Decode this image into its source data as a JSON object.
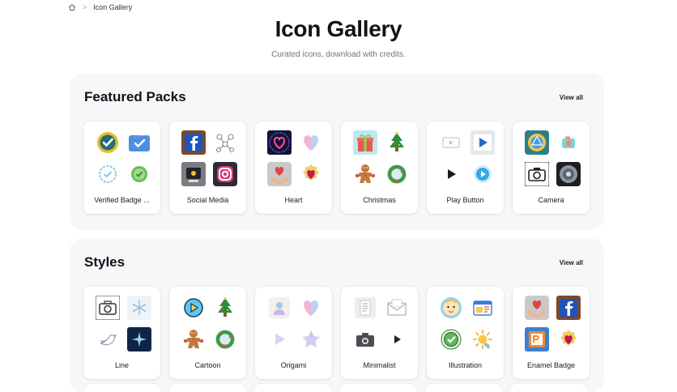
{
  "breadcrumb": {
    "home_icon": "home-icon",
    "separator": ">",
    "current": "Icon Gallery"
  },
  "page": {
    "title": "Icon Gallery",
    "subtitle": "Curated icons, download with credits."
  },
  "featured": {
    "title": "Featured Packs",
    "view_all": "View all",
    "packs": [
      {
        "label": "Verified Badge ...",
        "icons": [
          "verified-badge-icon",
          "verified-folder-icon",
          "check-circle-icon",
          "check-badge-icon"
        ]
      },
      {
        "label": "Social Media",
        "icons": [
          "facebook-icon",
          "network-icon",
          "webcam-icon",
          "instagram-icon"
        ]
      },
      {
        "label": "Heart",
        "icons": [
          "neon-heart-icon",
          "pastel-heart-icon",
          "hands-heart-icon",
          "heart-badge-icon"
        ]
      },
      {
        "label": "Christmas",
        "icons": [
          "gift-icon",
          "christmas-tree-icon",
          "gingerbread-icon",
          "wreath-icon"
        ]
      },
      {
        "label": "Play Button",
        "icons": [
          "video-play-icon",
          "play-tile-icon",
          "play-icon",
          "play-circle-icon"
        ]
      },
      {
        "label": "Camera",
        "icons": [
          "lens-icon",
          "camera-app-icon",
          "camera-outline-icon",
          "shutter-icon"
        ]
      }
    ]
  },
  "styles": {
    "title": "Styles",
    "view_all": "View all",
    "packs": [
      {
        "label": "Line",
        "icons": [
          "camera-line-icon",
          "snowflake-icon",
          "bird-icon",
          "sparkle-icon"
        ]
      },
      {
        "label": "Cartoon",
        "icons": [
          "play-cartoon-icon",
          "christmas-tree-icon",
          "gingerbread-icon",
          "wreath-icon"
        ]
      },
      {
        "label": "Origami",
        "icons": [
          "user-origami-icon",
          "pastel-heart-icon",
          "play-origami-icon",
          "star-origami-icon"
        ]
      },
      {
        "label": "Minimalist",
        "icons": [
          "document-icon",
          "mail-icon",
          "camera-min-icon",
          "play-min-icon"
        ]
      },
      {
        "label": "Illustration",
        "icons": [
          "baby-icon",
          "window-icon",
          "check-illus-icon",
          "sun-icon"
        ]
      },
      {
        "label": "Enamel Badge",
        "icons": [
          "hands-heart-icon",
          "facebook-icon",
          "presentation-icon",
          "heart-badge-icon"
        ]
      }
    ]
  }
}
